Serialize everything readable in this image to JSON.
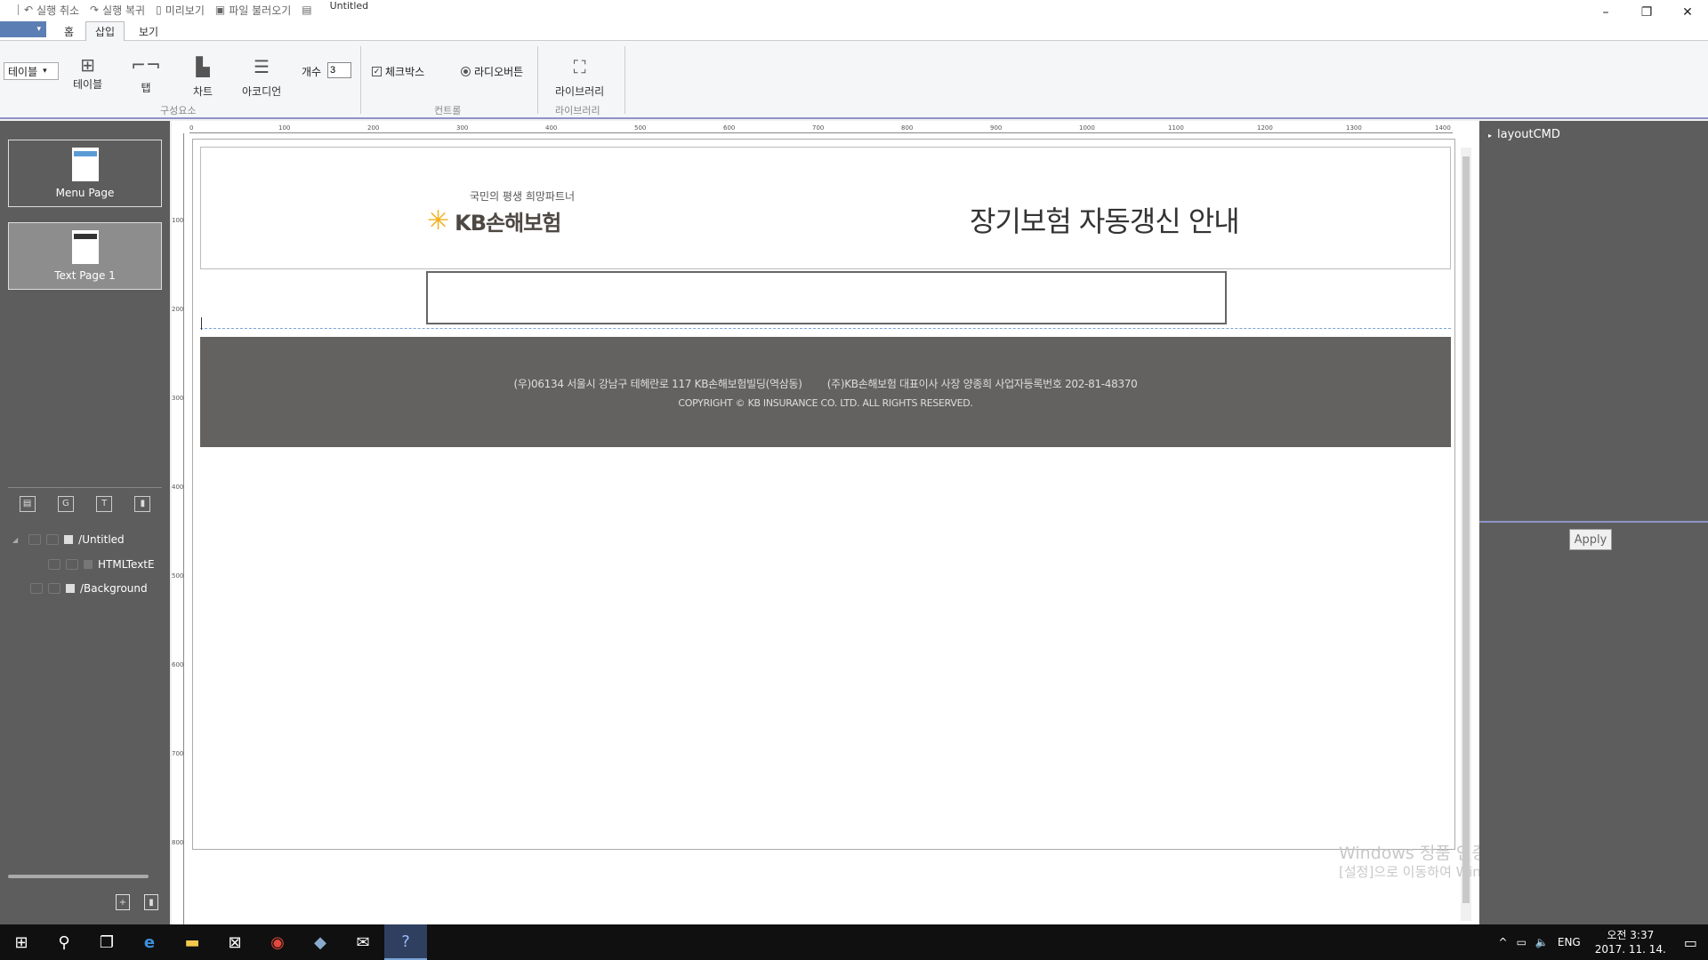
{
  "quick_access": {
    "undo": "실행 취소",
    "redo": "실행 복귀",
    "preview": "미리보기",
    "load_file": "파일 불러오기",
    "title": "Untitled"
  },
  "tabs": [
    "홈",
    "삽입",
    "보기"
  ],
  "ribbon": {
    "table_dropdown": "테이블",
    "table_button": "테이블",
    "tab_button": "탭",
    "chart_button": "차트",
    "accordion_button": "아코디언",
    "count_label": "개수",
    "count_value": "3",
    "group_components": "구성요소",
    "checkbox_button": "체크박스",
    "radio_button": "라디오버튼",
    "group_controls": "컨트롤",
    "library_button": "라이브러리",
    "group_library": "라이브러리"
  },
  "left_panel": {
    "pages": [
      "Menu Page",
      "Text Page 1"
    ],
    "layers": [
      {
        "label": "/Untitled"
      },
      {
        "label": "HTMLTextE"
      },
      {
        "label": "/Background"
      }
    ]
  },
  "document": {
    "logo_tagline": "국민의 평생 희망파트너",
    "logo_name": "KB손해보험",
    "header_title": "장기보험 자동갱신 안내",
    "footer_line1": "(우)06134 서울시 강남구 테헤란로 117 KB손해보험빌딩(역삼동)        (주)KB손해보험 대표이사 사장 양종희 사업자등록번호 202-81-48370",
    "footer_line2": "COPYRIGHT © KB INSURANCE CO. LTD. ALL RIGHTS RESERVED."
  },
  "ruler": {
    "horizontal": [
      "0",
      "100",
      "200",
      "300",
      "400",
      "500",
      "600",
      "700",
      "800",
      "900",
      "1000",
      "1100",
      "1200",
      "1300",
      "1400"
    ],
    "vertical": [
      "100",
      "200",
      "300",
      "400",
      "500",
      "600",
      "700",
      "800"
    ]
  },
  "right_panel": {
    "tree_root": "layoutCMD",
    "apply_label": "Apply"
  },
  "watermark": {
    "line1": "Windows 정품 인증",
    "line2": "[설정]으로 이동하여 Windows를 정품 인증합니다."
  },
  "taskbar": {
    "lang": "ENG",
    "time": "오전 3:37",
    "date": "2017. 11. 14."
  },
  "colors": {
    "accent": "#8f93c9",
    "panel_bg": "#5e5d5d",
    "footer_bg": "#646261",
    "kb_yellow": "#f2b01e"
  }
}
